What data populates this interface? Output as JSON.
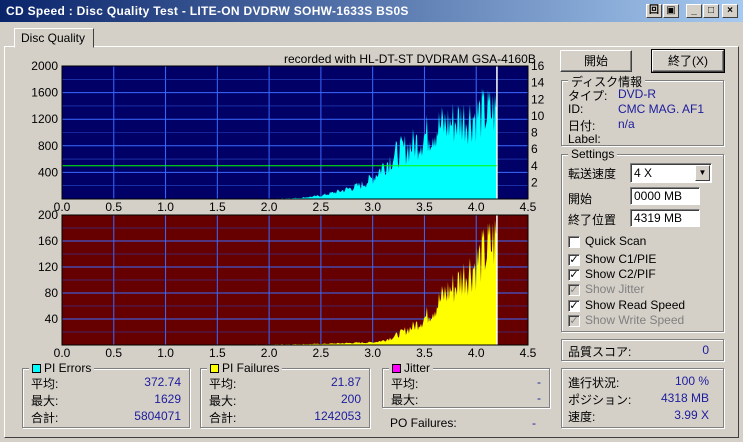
{
  "window": {
    "title": "CD Speed : Disc Quality Test - LITE-ON DVDRW SOHW-1633S BS0S",
    "btn_a": "回",
    "btn_b": "▣",
    "btn_min": "_",
    "btn_max": "□",
    "btn_close": "×"
  },
  "tab": {
    "label": "Disc Quality"
  },
  "recorded_with": "recorded with HL-DT-ST DVDRAM GSA-4160B",
  "colors": {
    "plot_bg_top": "#000066",
    "plot_bg_bottom": "#660000",
    "pi_errors": "#00ffff",
    "pi_failures": "#ffff00",
    "jitter": "#ff00ff",
    "speed_line": "#00ff00",
    "label_blue": "#1c1c9c"
  },
  "buttons": {
    "start": "開始",
    "exit": "終了(X)"
  },
  "disc_info": {
    "group_title": "ディスク情報",
    "type_label": "タイプ:",
    "type_value": "DVD-R",
    "id_label": "ID:",
    "id_value": "CMC MAG. AF1",
    "date_label": "日付:",
    "date_value": "n/a",
    "label_label": "Label:",
    "label_value": ""
  },
  "settings": {
    "group_title": "Settings",
    "speed_label": "転送速度",
    "speed_value": "4 X",
    "start_label": "開始",
    "start_value": "0000 MB",
    "end_label": "終了位置",
    "end_value": "4319 MB",
    "quick_scan": "Quick Scan",
    "show_c1": "Show C1/PIE",
    "show_c2": "Show C2/PIF",
    "show_jitter": "Show Jitter",
    "show_read": "Show Read Speed",
    "show_write": "Show Write Speed"
  },
  "quality": {
    "label": "品質スコア:",
    "value": "0"
  },
  "progress": {
    "progress_label": "進行状況:",
    "progress_value": "100 %",
    "position_label": "ポジション:",
    "position_value": "4318 MB",
    "speed_label": "速度:",
    "speed_value": "3.99 X"
  },
  "pi_errors": {
    "title": "PI Errors",
    "avg_label": "平均:",
    "avg": "372.74",
    "max_label": "最大:",
    "max": "1629",
    "total_label": "合計:",
    "total": "5804071"
  },
  "pi_failures": {
    "title": "PI Failures",
    "avg_label": "平均:",
    "avg": "21.87",
    "max_label": "最大:",
    "max": "200",
    "total_label": "合計:",
    "total": "1242053"
  },
  "jitter": {
    "title": "Jitter",
    "avg_label": "平均:",
    "avg": "-",
    "max_label": "最大:",
    "max": "-"
  },
  "po_failures": {
    "label": "PO Failures:",
    "value": "-"
  },
  "chart_data": [
    {
      "type": "area",
      "series": [
        {
          "name": "PI Errors",
          "x": [
            0,
            0.5,
            1.0,
            1.5,
            2.0,
            2.3,
            2.5,
            2.7,
            2.9,
            3.0,
            3.1,
            3.2,
            3.3,
            3.4,
            3.5,
            3.6,
            3.7,
            3.8,
            3.9,
            4.0,
            4.1,
            4.2
          ],
          "values": [
            0,
            0,
            0,
            0,
            5,
            20,
            60,
            150,
            260,
            380,
            600,
            780,
            900,
            1000,
            1150,
            1280,
            1350,
            1420,
            1480,
            1520,
            1560,
            1600
          ]
        }
      ],
      "x_ticks": [
        "0.0",
        "0.5",
        "1.0",
        "1.5",
        "2.0",
        "2.5",
        "3.0",
        "3.5",
        "4.0",
        "4.5"
      ],
      "y_ticks": [
        "400",
        "800",
        "1200",
        "1600",
        "2000"
      ],
      "y2_ticks": [
        "2",
        "4",
        "6",
        "8",
        "10",
        "12",
        "14",
        "16"
      ],
      "xlim": [
        0,
        4.5
      ],
      "ylim": [
        0,
        2000
      ],
      "y2lim": [
        0,
        16
      ],
      "speed_line_value": 4
    },
    {
      "type": "area",
      "series": [
        {
          "name": "PI Failures",
          "x": [
            0,
            1.0,
            2.0,
            2.5,
            3.0,
            3.1,
            3.2,
            3.3,
            3.4,
            3.5,
            3.6,
            3.7,
            3.8,
            3.9,
            4.0,
            4.1,
            4.2
          ],
          "values": [
            0,
            0,
            1,
            2,
            5,
            8,
            15,
            25,
            35,
            50,
            70,
            95,
            110,
            135,
            150,
            175,
            200
          ]
        }
      ],
      "x_ticks": [
        "0.0",
        "0.5",
        "1.0",
        "1.5",
        "2.0",
        "2.5",
        "3.0",
        "3.5",
        "4.0",
        "4.5"
      ],
      "y_ticks": [
        "40",
        "80",
        "120",
        "160",
        "200"
      ],
      "xlim": [
        0,
        4.5
      ],
      "ylim": [
        0,
        200
      ]
    }
  ]
}
